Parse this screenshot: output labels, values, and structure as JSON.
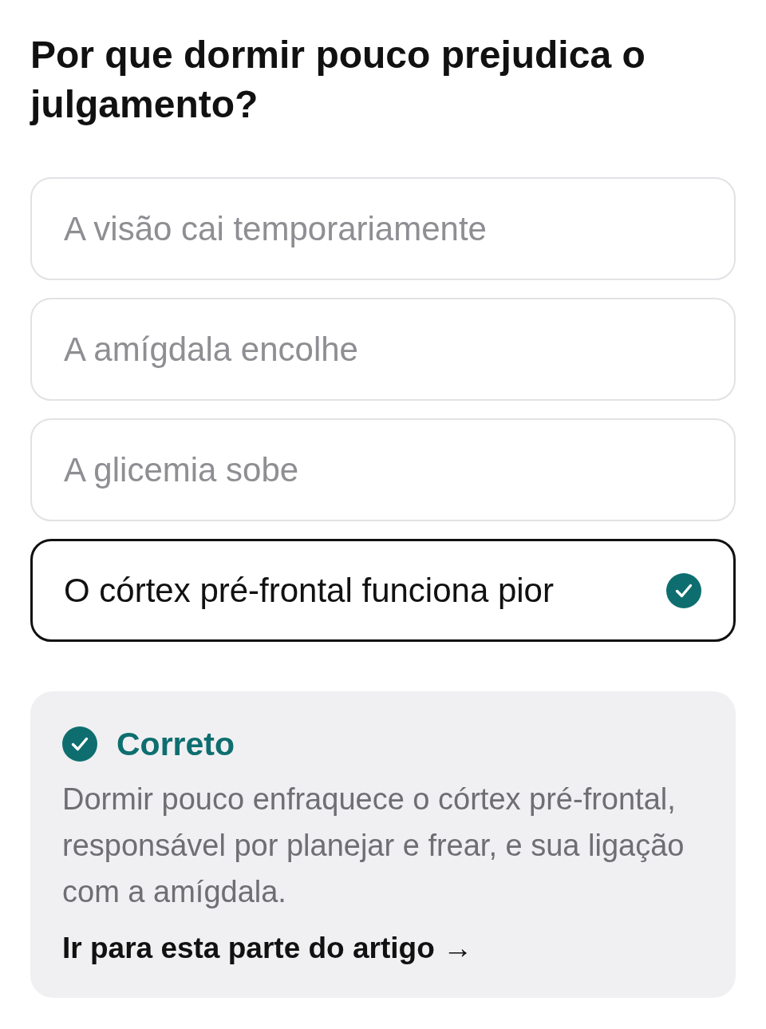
{
  "question": {
    "title": "Por que dormir pouco prejudica o julgamento?"
  },
  "options": [
    {
      "label": "A visão cai temporariamente",
      "selected": false
    },
    {
      "label": "A amígdala encolhe",
      "selected": false
    },
    {
      "label": "A glicemia sobe",
      "selected": false
    },
    {
      "label": "O córtex pré-frontal funciona pior",
      "selected": true
    }
  ],
  "feedback": {
    "kind": "correct",
    "title": "Correto",
    "text": "Dormir pouco enfraquece o córtex pré-frontal, responsável por planejar e frear, e sua ligação com a amígdala.",
    "link": "Ir para esta parte do artigo →"
  }
}
